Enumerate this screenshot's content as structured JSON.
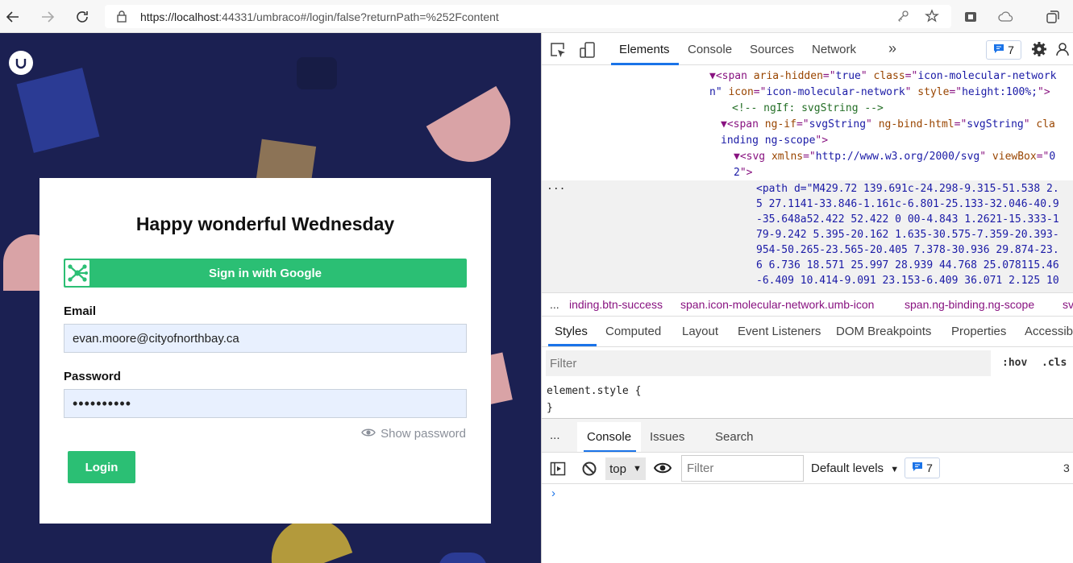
{
  "browser": {
    "url_host": "https://localhost",
    "url_rest": ":44331/umbraco#/login/false?returnPath=%252Fcontent"
  },
  "login": {
    "title": "Happy wonderful Wednesday",
    "google_button": "Sign in with Google",
    "email_label": "Email",
    "email_value": "evan.moore@cityofnorthbay.ca",
    "password_label": "Password",
    "password_value": "••••••••••",
    "show_password": "Show password",
    "login_button": "Login"
  },
  "devtools": {
    "tabs": [
      "Elements",
      "Console",
      "Sources",
      "Network"
    ],
    "more_tabs": "»",
    "issues_count": "7",
    "code_lines": [
      {
        "ind": "",
        "parts": [
          [
            "tag",
            "▼<span "
          ],
          [
            "at",
            "aria-hidden"
          ],
          [
            "tag",
            "=\""
          ],
          [
            "av",
            "true"
          ],
          [
            "tag",
            "\" "
          ],
          [
            "at",
            "class"
          ],
          [
            "tag",
            "=\""
          ],
          [
            "av",
            "icon-molecular-network"
          ]
        ]
      },
      {
        "ind": "",
        "parts": [
          [
            "av",
            "n\" "
          ],
          [
            "at",
            "icon"
          ],
          [
            "tag",
            "=\""
          ],
          [
            "av",
            "icon-molecular-network"
          ],
          [
            "tag",
            "\" "
          ],
          [
            "at",
            "style"
          ],
          [
            "tag",
            "=\""
          ],
          [
            "av",
            "height:100%;"
          ],
          [
            "tag",
            "\">"
          ]
        ]
      },
      {
        "ind": "",
        "parts": [
          [
            "cm",
            "<!-- ngIf: svgString -->"
          ]
        ]
      },
      {
        "ind": "",
        "parts": [
          [
            "tag",
            "▼<span "
          ],
          [
            "at",
            "ng-if"
          ],
          [
            "tag",
            "=\""
          ],
          [
            "av",
            "svgString"
          ],
          [
            "tag",
            "\" "
          ],
          [
            "at",
            "ng-bind-html"
          ],
          [
            "tag",
            "=\""
          ],
          [
            "av",
            "svgString"
          ],
          [
            "tag",
            "\" "
          ],
          [
            "at",
            "cla"
          ]
        ]
      },
      {
        "ind": "",
        "parts": [
          [
            "av",
            "inding ng-scope"
          ],
          [
            "tag",
            "\">"
          ]
        ]
      },
      {
        "ind": "",
        "parts": [
          [
            "tag",
            "▼<svg "
          ],
          [
            "at",
            "xmlns"
          ],
          [
            "tag",
            "=\""
          ],
          [
            "av",
            "http://www.w3.org/2000/svg"
          ],
          [
            "tag",
            "\" "
          ],
          [
            "at",
            "viewBox"
          ],
          [
            "tag",
            "=\""
          ],
          [
            "av",
            "0"
          ]
        ]
      },
      {
        "ind": "",
        "parts": [
          [
            "av",
            "2"
          ],
          [
            "tag",
            "\">"
          ]
        ]
      }
    ],
    "path_lines": [
      "<path d=\"M429.72 139.691c-24.298-9.315-51.538 2.",
      "5 27.1141-33.846-1.161c-6.801-25.133-32.046-40.9",
      "-35.648a52.422 52.422 0 00-4.843 1.2621-15.333-1",
      "79-9.242 5.395-20.162 1.635-30.575-7.359-20.393-",
      "954-50.265-23.565-20.405 7.378-30.936 29.874-23.",
      "6 6.736 18.571 25.997 28.939 44.768 25.078115.46",
      "-6.409 10.414-9.091 23.153-6.409 36.071 2.125 10"
    ],
    "ellipsis": "...",
    "crumbs": [
      "inding.btn-success",
      "span.icon-molecular-network.umb-icon",
      "span.ng-binding.ng-scope",
      "svg"
    ],
    "style_tabs": [
      "Styles",
      "Computed",
      "Layout",
      "Event Listeners",
      "DOM Breakpoints",
      "Properties",
      "Accessibi"
    ],
    "filter_placeholder": "Filter",
    "hov": ":hov",
    "cls": ".cls",
    "element_style": "element.style {",
    "close_brace": "}",
    "drawer_tabs": [
      "Console",
      "Issues",
      "Search"
    ],
    "context": "top",
    "console_filter": "Filter",
    "default_levels": "Default levels",
    "console_count": "7",
    "hidden_count": "3",
    "prompt": "›"
  },
  "colors": {
    "page_bg": "#1b2052",
    "brand_green": "#2bbf74",
    "accent_blue": "#1a73e8"
  }
}
